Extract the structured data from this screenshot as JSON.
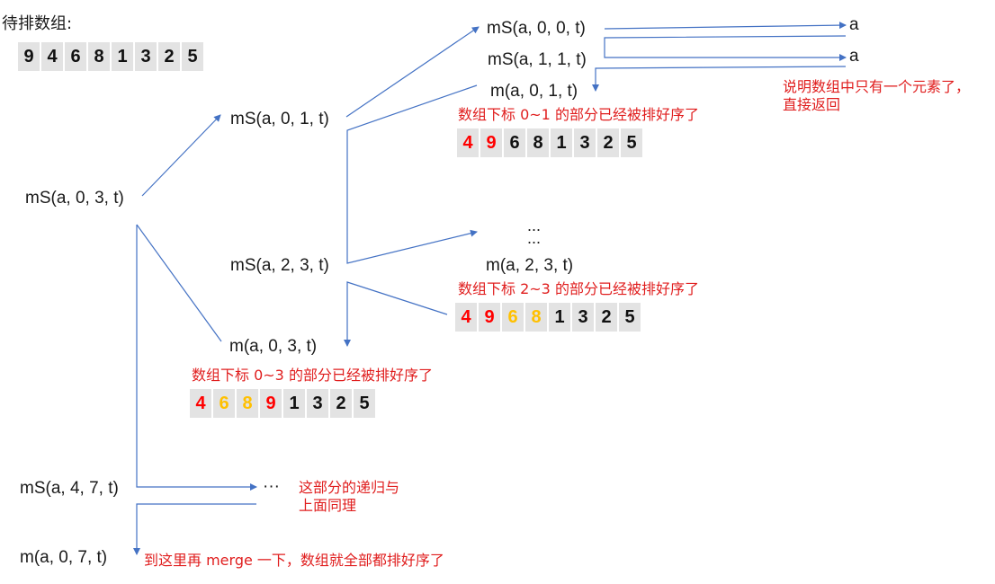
{
  "title": "待排数组:",
  "initial_array": [
    "9",
    "4",
    "6",
    "8",
    "1",
    "3",
    "2",
    "5"
  ],
  "calls": {
    "ms_0_3": "mS(a, 0, 3, t)",
    "ms_0_1": "mS(a, 0, 1, t)",
    "ms_2_3": "mS(a, 2, 3, t)",
    "ms_0_0": "mS(a, 0, 0, t)",
    "ms_1_1": "mS(a, 1, 1, t)",
    "m_0_1": "m(a, 0, 1, t)",
    "m_2_3": "m(a, 2, 3, t)",
    "m_0_3": "m(a, 0, 3, t)",
    "ms_4_7": "mS(a, 4, 7, t)",
    "m_0_7": "m(a, 0, 7, t)"
  },
  "returns": {
    "a1": "a",
    "a2": "a"
  },
  "ellipsis": {
    "top": "...",
    "bottom": "...",
    "right": "···"
  },
  "notes": {
    "single": "说明数组中只有一个元素了，",
    "single2": "直接返回",
    "sorted_0_1": "数组下标 0~1 的部分已经被排好序了",
    "sorted_2_3": "数组下标 2~3 的部分已经被排好序了",
    "sorted_0_3": "数组下标 0~3 的部分已经被排好序了",
    "recursion": "这部分的递归与",
    "recursion2": "上面同理",
    "final": "到这里再 merge 一下，数组就全部都排好序了"
  },
  "arrays": {
    "after_0_1": {
      "values": [
        "4",
        "9",
        "6",
        "8",
        "1",
        "3",
        "2",
        "5"
      ],
      "colors": [
        "red",
        "red",
        "",
        "",
        "",
        "",
        "",
        ""
      ]
    },
    "after_2_3": {
      "values": [
        "4",
        "9",
        "6",
        "8",
        "1",
        "3",
        "2",
        "5"
      ],
      "colors": [
        "red",
        "red",
        "orange",
        "orange",
        "",
        "",
        "",
        ""
      ]
    },
    "after_0_3": {
      "values": [
        "4",
        "6",
        "8",
        "9",
        "1",
        "3",
        "2",
        "5"
      ],
      "colors": [
        "red",
        "orange",
        "orange",
        "red",
        "",
        "",
        "",
        ""
      ]
    }
  },
  "colors": {
    "arrow": "#4472c4",
    "note": "#e01e1e",
    "highlight_red": "#ff0000",
    "highlight_orange": "#ffc000",
    "cell_bg": "#e3e3e3"
  }
}
